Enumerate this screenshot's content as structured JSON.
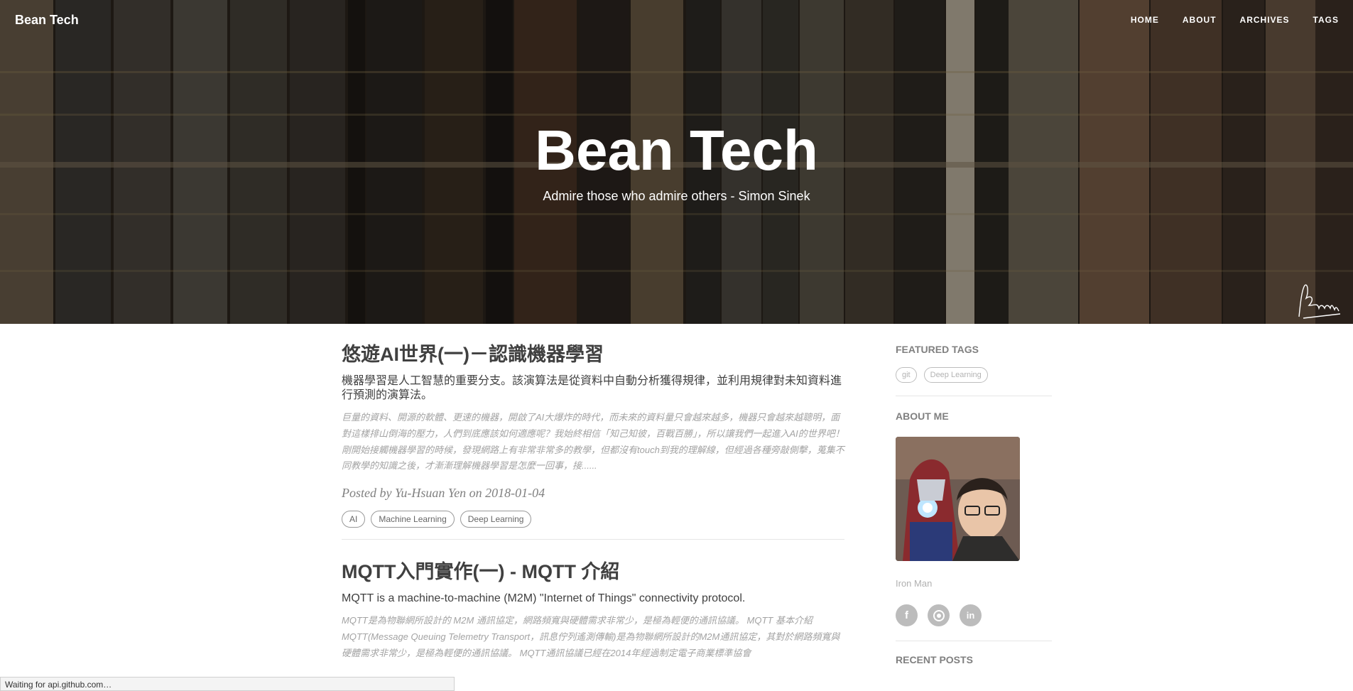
{
  "header": {
    "brand": "Bean Tech",
    "nav": [
      "HOME",
      "ABOUT",
      "ARCHIVES",
      "TAGS"
    ],
    "title": "Bean Tech",
    "subtitle": "Admire those who admire others - Simon Sinek"
  },
  "posts": [
    {
      "title": "悠遊AI世界(一)－認識機器學習",
      "subtitle": "機器學習是人工智慧的重要分支。該演算法是從資料中自動分析獲得規律，並利用規律對未知資料進行預測的演算法。",
      "excerpt": "巨量的資料、開源的軟體、更速的機器，開啟了AI大爆炸的時代，而未來的資料量只會越來越多，機器只會越來越聰明，面對這樣排山倒海的壓力，人們到底應該如何適應呢？我始終相信「知己知彼，百戰百勝」，所以讓我們一起進入AI的世界吧！ 剛開始接觸機器學習的時候，發現網路上有非常非常多的教學，但都沒有touch到我的理解線，但經過各種旁敲側擊，蒐集不同教學的知識之後，才漸漸理解機器學習是怎麼一回事，接......",
      "meta": "Posted by Yu-Hsuan Yen on 2018-01-04",
      "tags": [
        "AI",
        "Machine Learning",
        "Deep Learning"
      ]
    },
    {
      "title": "MQTT入門實作(一) - MQTT 介紹",
      "subtitle": "MQTT is a machine-to-machine (M2M) \"Internet of Things\" connectivity protocol.",
      "excerpt": "MQTT是為物聯網所設計的 M2M 通訊協定，網路頻寬與硬體需求非常少，是極為輕便的通訊協議。 MQTT 基本介紹 MQTT(Message Queuing Telemetry Transport，訊息佇列遙測傳輸)是為物聯網所設計的M2M通訊協定，其對於網路頻寬與硬體需求非常少，是極為輕便的通訊協議。 MQTT通訊協議已經在2014年經過制定電子商業標準協會"
    }
  ],
  "sidebar": {
    "featured_tags_title": "FEATURED TAGS",
    "featured_tags": [
      "git",
      "Deep Learning"
    ],
    "about_title": "ABOUT ME",
    "nickname": "Iron Man",
    "social_icons": [
      "facebook-icon",
      "github-icon",
      "linkedin-icon"
    ],
    "recent_posts_title": "RECENT POSTS"
  },
  "status_bar": "Waiting for api.github.com…",
  "colors": {
    "text": "#404040",
    "muted": "#808080",
    "excerpt": "#a3a3a3",
    "social": "#bcbcbc"
  }
}
